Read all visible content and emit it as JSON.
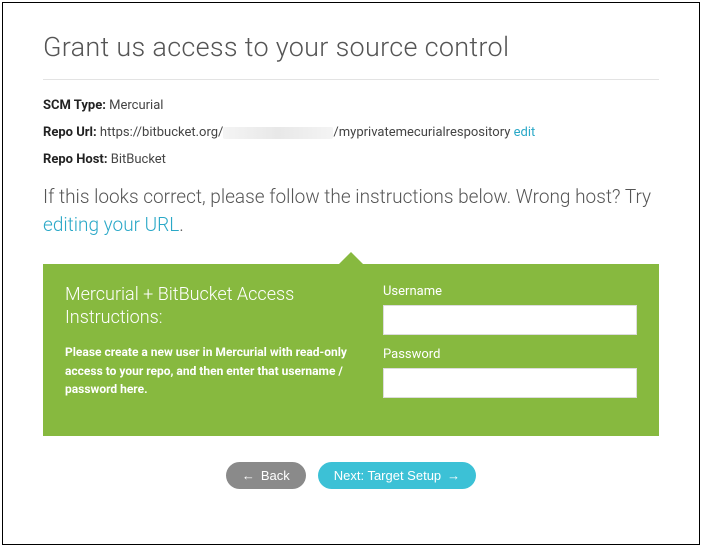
{
  "header": {
    "title": "Grant us access to your source control"
  },
  "scm": {
    "type_label": "SCM Type:",
    "type_value": "Mercurial",
    "url_label": "Repo Url:",
    "url_prefix": "https://bitbucket.org/",
    "url_suffix": "/myprivatemecurialrespository",
    "url_edit": "edit",
    "host_label": "Repo Host:",
    "host_value": "BitBucket"
  },
  "instructions": {
    "text_a": "If this looks correct, please follow the instructions below. Wrong host? Try ",
    "link": "editing your URL",
    "text_b": "."
  },
  "panel": {
    "title": "Mercurial + BitBucket Access Instructions:",
    "body": "Please create a new user in Mercurial with read-only access to your repo, and then enter that username / password here.",
    "username_label": "Username",
    "password_label": "Password"
  },
  "buttons": {
    "back": "Back",
    "next": "Next: Target Setup"
  }
}
